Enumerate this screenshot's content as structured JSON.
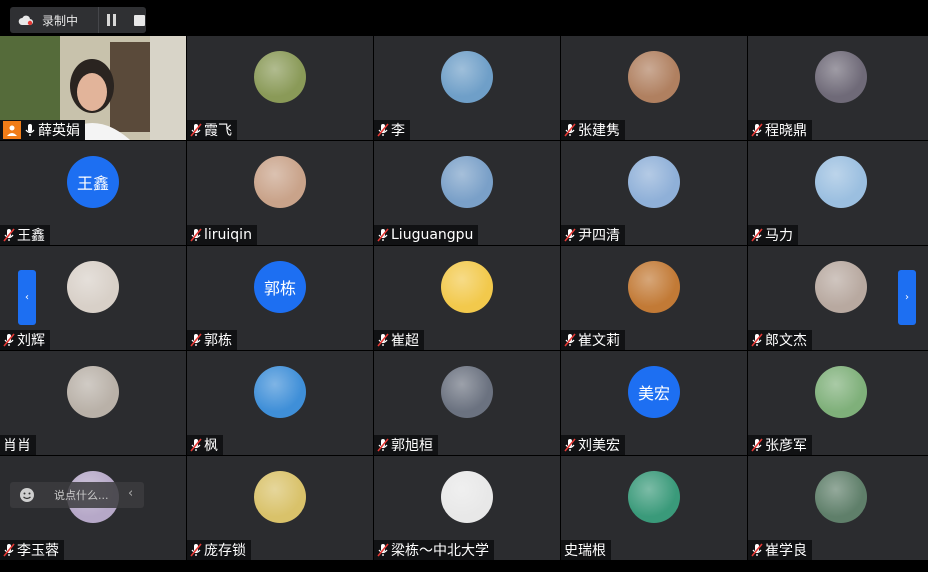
{
  "recording": {
    "label": "录制中",
    "icons": [
      "cloud-icon",
      "pause-icon",
      "stop-icon"
    ]
  },
  "self_tile": {
    "name": "薛英娟",
    "icons": [
      "person-icon",
      "mic-on-icon"
    ]
  },
  "participants": [
    {
      "name": "霞飞",
      "avatar": "photo",
      "color": "#8a9a58"
    },
    {
      "name": "李",
      "avatar": "photo",
      "color": "#6f9fc8"
    },
    {
      "name": "张建隽",
      "avatar": "photo",
      "color": "#b08060"
    },
    {
      "name": "程晓鼎",
      "avatar": "photo",
      "color": "#6f6a78"
    },
    {
      "name": "王鑫",
      "avatar": "text",
      "avatar_text": "王鑫"
    },
    {
      "name": "liruiqin",
      "avatar": "photo",
      "color": "#c9a38a"
    },
    {
      "name": "Liuguangpu",
      "avatar": "photo",
      "color": "#7aa0c8"
    },
    {
      "name": "尹四清",
      "avatar": "photo",
      "color": "#8fb0d8"
    },
    {
      "name": "马力",
      "avatar": "photo",
      "color": "#9bbfe0"
    },
    {
      "name": "刘辉",
      "avatar": "photo",
      "color": "#d8d0c8"
    },
    {
      "name": "郭栋",
      "avatar": "text",
      "avatar_text": "郭栋"
    },
    {
      "name": "崔超",
      "avatar": "photo",
      "color": "#f2c94c"
    },
    {
      "name": "崔文莉",
      "avatar": "photo",
      "color": "#c27a36"
    },
    {
      "name": "郎文杰",
      "avatar": "photo",
      "color": "#b8a9a0"
    },
    {
      "name": "肖肖",
      "avatar": "photo",
      "color": "#b9b1a8",
      "mic": false
    },
    {
      "name": "枫",
      "avatar": "photo",
      "color": "#3f8fd8"
    },
    {
      "name": "郭旭桓",
      "avatar": "photo",
      "color": "#6b7280"
    },
    {
      "name": "刘美宏",
      "avatar": "text",
      "avatar_text": "美宏"
    },
    {
      "name": "张彦军",
      "avatar": "photo",
      "color": "#7fb07a"
    },
    {
      "name": "李玉蓉",
      "avatar": "photo",
      "color": "#b6a8c8"
    },
    {
      "name": "庞存锁",
      "avatar": "photo",
      "color": "#d9c26a"
    },
    {
      "name": "梁栋～中北大学",
      "avatar": "photo",
      "color": "#e8e8e8"
    },
    {
      "name": "史瑞根",
      "avatar": "photo",
      "color": "#3a9a7a",
      "mic": false
    },
    {
      "name": "崔学良",
      "avatar": "photo",
      "color": "#5f7f6a"
    }
  ],
  "nav": {
    "prev": "‹",
    "next": "›"
  },
  "chat": {
    "placeholder": "说点什么...",
    "collapse": "‹"
  }
}
